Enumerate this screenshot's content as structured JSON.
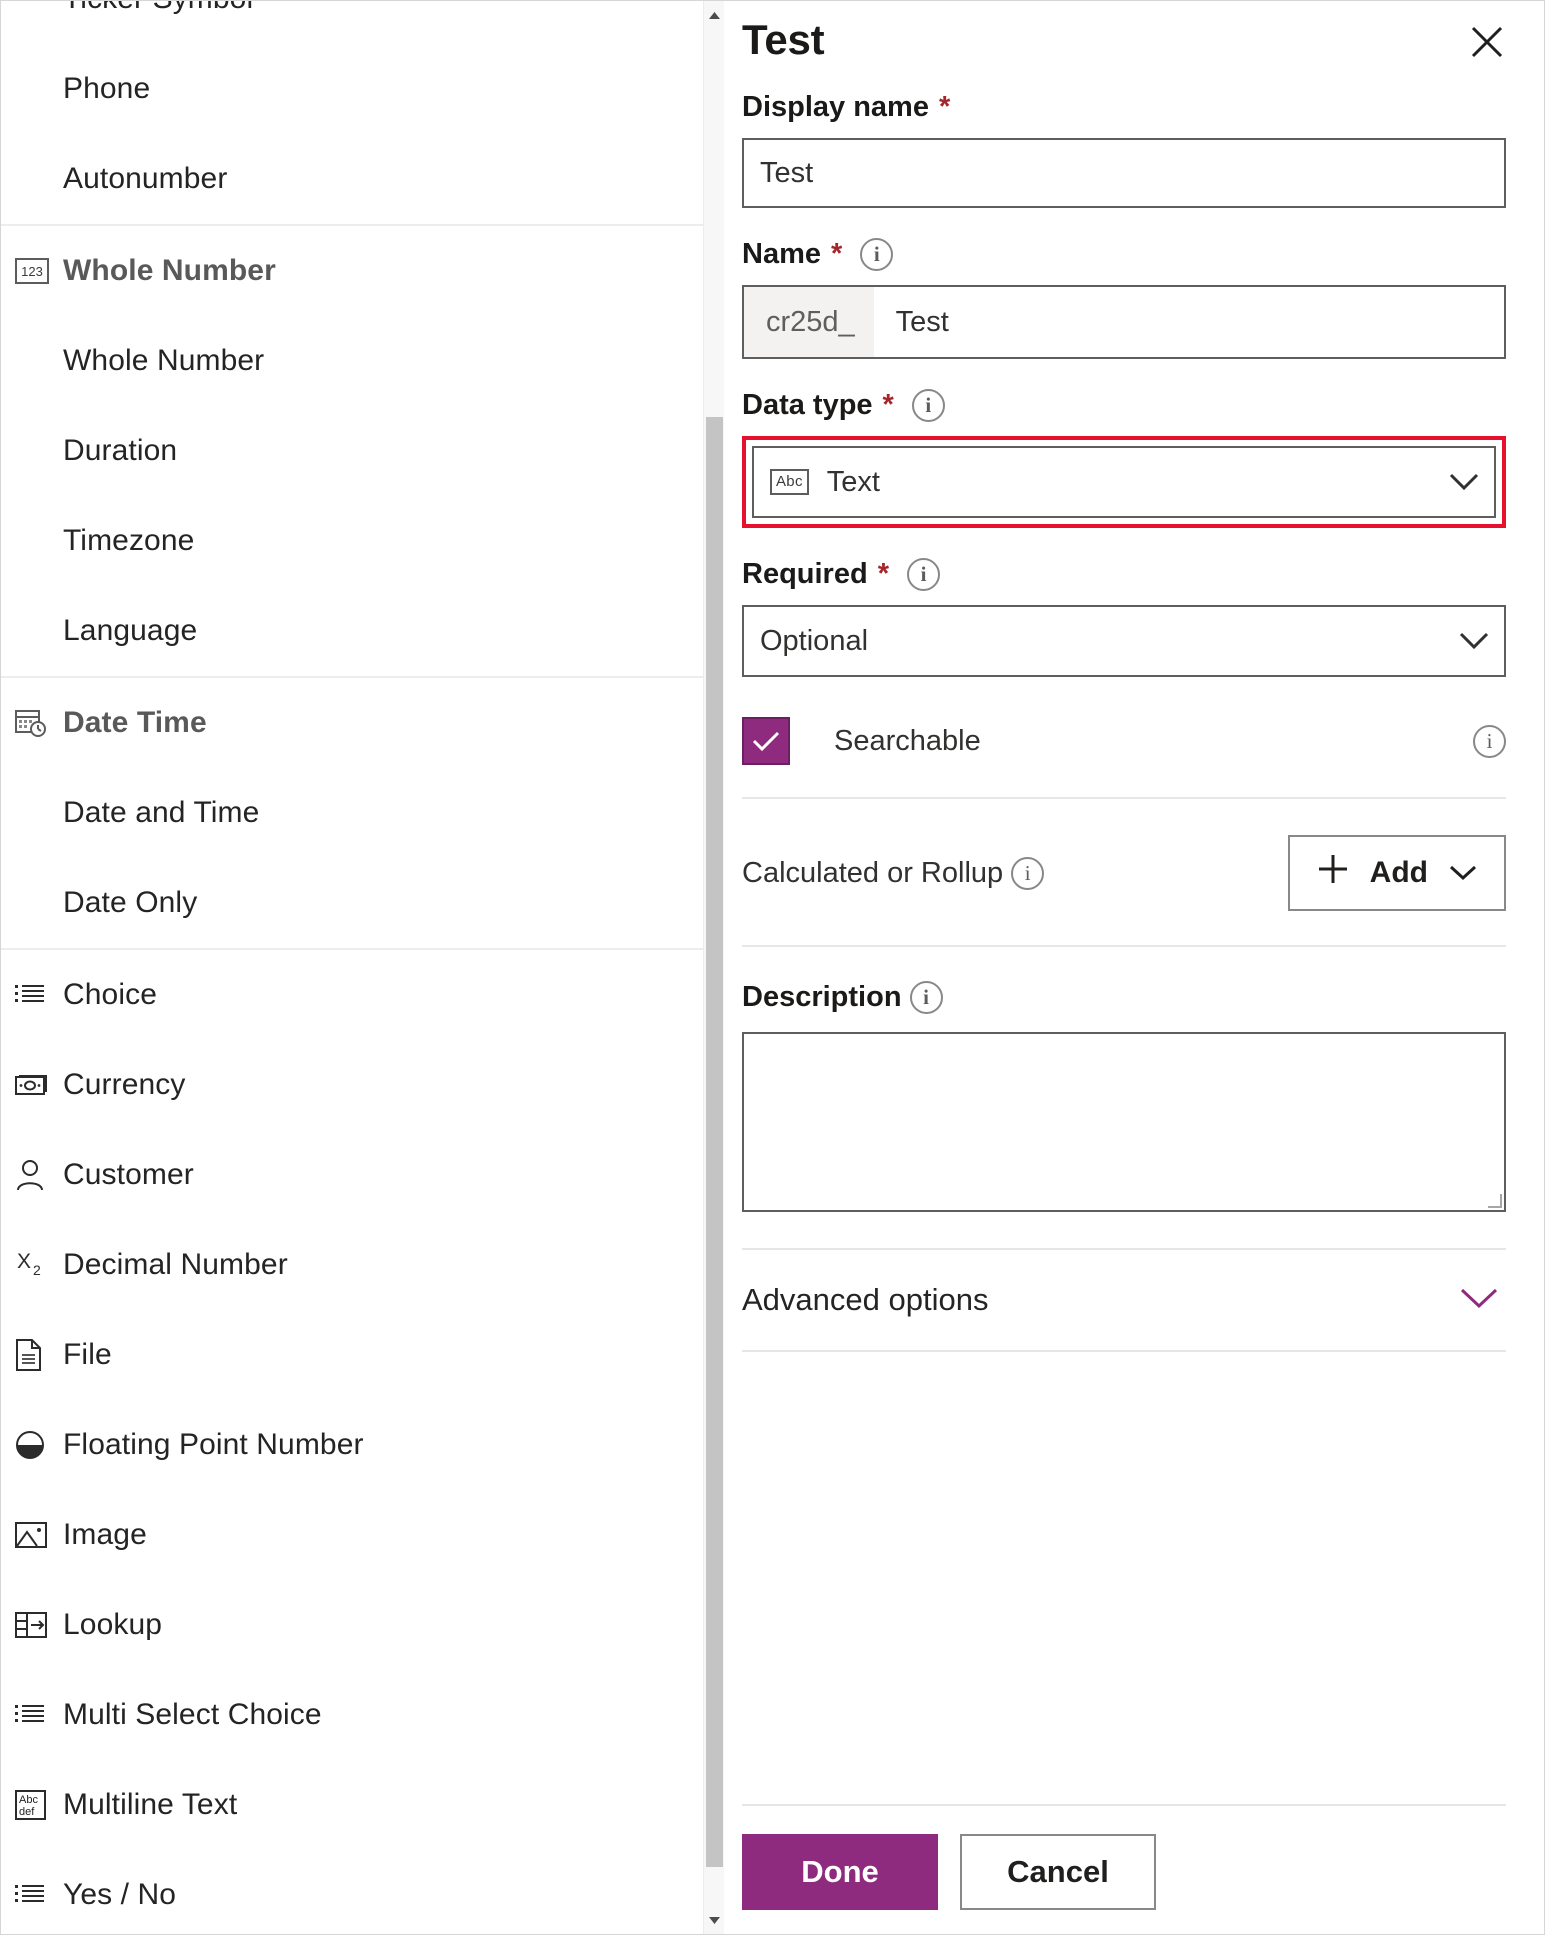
{
  "colors": {
    "accent": "#8e2b7e",
    "highlight_border": "#e8112d",
    "required_asterisk": "#a4262c",
    "label_text": "#1b1a19",
    "body_text": "#323130"
  },
  "data_type_list": {
    "groups": [
      {
        "header": null,
        "items": [
          {
            "label": "Ticker Symbol",
            "icon": null,
            "level": "child",
            "clipped": true
          },
          {
            "label": "Phone",
            "icon": null,
            "level": "child"
          },
          {
            "label": "Autonumber",
            "icon": null,
            "level": "child"
          }
        ]
      },
      {
        "header": {
          "label": "Whole Number",
          "icon": "123-box-icon"
        },
        "items": [
          {
            "label": "Whole Number",
            "icon": null,
            "level": "child"
          },
          {
            "label": "Duration",
            "icon": null,
            "level": "child"
          },
          {
            "label": "Timezone",
            "icon": null,
            "level": "child"
          },
          {
            "label": "Language",
            "icon": null,
            "level": "child"
          }
        ]
      },
      {
        "header": {
          "label": "Date Time",
          "icon": "calendar-clock-icon"
        },
        "items": [
          {
            "label": "Date and Time",
            "icon": null,
            "level": "child"
          },
          {
            "label": "Date Only",
            "icon": null,
            "level": "child"
          }
        ]
      },
      {
        "header": null,
        "items": [
          {
            "label": "Choice",
            "icon": "list-icon",
            "level": "top"
          },
          {
            "label": "Currency",
            "icon": "money-icon",
            "level": "top"
          },
          {
            "label": "Customer",
            "icon": "person-icon",
            "level": "top"
          },
          {
            "label": "Decimal Number",
            "icon": "x-subscript-2-icon",
            "level": "top"
          },
          {
            "label": "File",
            "icon": "document-icon",
            "level": "top"
          },
          {
            "label": "Floating Point Number",
            "icon": "half-filled-circle-icon",
            "level": "top"
          },
          {
            "label": "Image",
            "icon": "image-icon",
            "level": "top"
          },
          {
            "label": "Lookup",
            "icon": "lookup-table-arrow-icon",
            "level": "top"
          },
          {
            "label": "Multi Select Choice",
            "icon": "list-icon",
            "level": "top"
          },
          {
            "label": "Multiline Text",
            "icon": "abc-def-box-icon",
            "level": "top"
          },
          {
            "label": "Yes / No",
            "icon": "list-icon",
            "level": "top"
          }
        ]
      }
    ],
    "scrollbar": {
      "up_arrow": "chevron-up-icon",
      "down_arrow": "chevron-down-icon"
    }
  },
  "panel": {
    "title": "Test",
    "close_icon": "close-icon",
    "display_name": {
      "label": "Display name",
      "required_marker": "*",
      "value": "Test",
      "placeholder": ""
    },
    "name": {
      "label": "Name",
      "required_marker": "*",
      "info_icon": "info-icon",
      "prefix": "cr25d_",
      "value": "Test"
    },
    "data_type": {
      "label": "Data type",
      "required_marker": "*",
      "info_icon": "info-icon",
      "selected": "Text",
      "selected_icon": "abc-box-icon",
      "chevron": "chevron-down-icon",
      "highlighted": true
    },
    "required": {
      "label": "Required",
      "required_marker": "*",
      "info_icon": "info-icon",
      "selected": "Optional",
      "chevron": "chevron-down-icon"
    },
    "searchable": {
      "label": "Searchable",
      "checked": true,
      "check_icon": "checkmark-icon",
      "info_icon": "info-icon"
    },
    "calculated_or_rollup": {
      "label": "Calculated or Rollup",
      "info_icon": "info-icon",
      "add_button": {
        "label": "Add",
        "plus_icon": "plus-icon",
        "chevron": "chevron-down-icon"
      }
    },
    "description": {
      "label": "Description",
      "info_icon": "info-icon",
      "value": "",
      "placeholder": ""
    },
    "advanced_options": {
      "label": "Advanced options",
      "chevron": "chevron-down-icon",
      "expanded": false
    },
    "footer": {
      "done_label": "Done",
      "cancel_label": "Cancel"
    }
  }
}
